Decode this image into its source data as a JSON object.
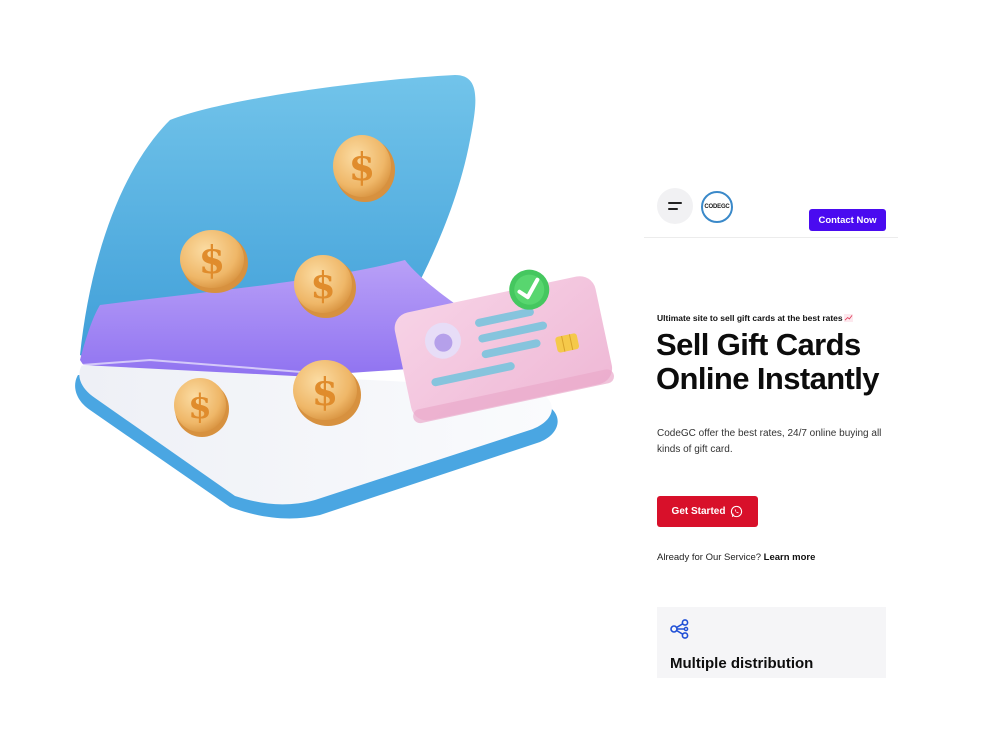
{
  "brand": {
    "logo_text": "CODEGC",
    "accent_color": "#4a0bf0",
    "cta_color": "#d8102a"
  },
  "header": {
    "menu_icon": "hamburger-icon",
    "contact_label": "Contact Now"
  },
  "hero": {
    "eyebrow": "Ultimate site to sell gift cards at the best rates",
    "eyebrow_icon": "chart-increasing-icon",
    "headline_line1": "Sell Gift Cards",
    "headline_line2": "Online Instantly",
    "description": "CodeGC offer the best rates, 24/7 online buying all kinds of gift card.",
    "cta_label": "Get Started",
    "cta_icon": "whatsapp-icon",
    "already_text": "Already for Our Service?",
    "learn_more": "Learn more"
  },
  "features": [
    {
      "icon": "share-nodes-icon",
      "title": "Multiple distribution"
    }
  ]
}
